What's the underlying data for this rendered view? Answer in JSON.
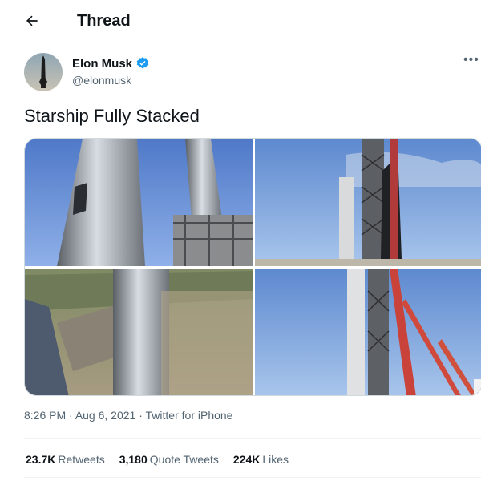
{
  "header": {
    "title": "Thread"
  },
  "author": {
    "name": "Elon Musk",
    "handle": "@elonmusk"
  },
  "tweet": {
    "text": "Starship Fully Stacked"
  },
  "meta": {
    "time": "8:26 PM",
    "date": "Aug 6, 2021",
    "source": "Twitter for iPhone",
    "sep": " · "
  },
  "stats": [
    {
      "value": "23.7K",
      "label": "Retweets"
    },
    {
      "value": "3,180",
      "label": "Quote Tweets"
    },
    {
      "value": "224K",
      "label": "Likes"
    }
  ],
  "colors": {
    "accent": "#1d9bf0",
    "text": "#0f1419",
    "muted": "#536471"
  }
}
